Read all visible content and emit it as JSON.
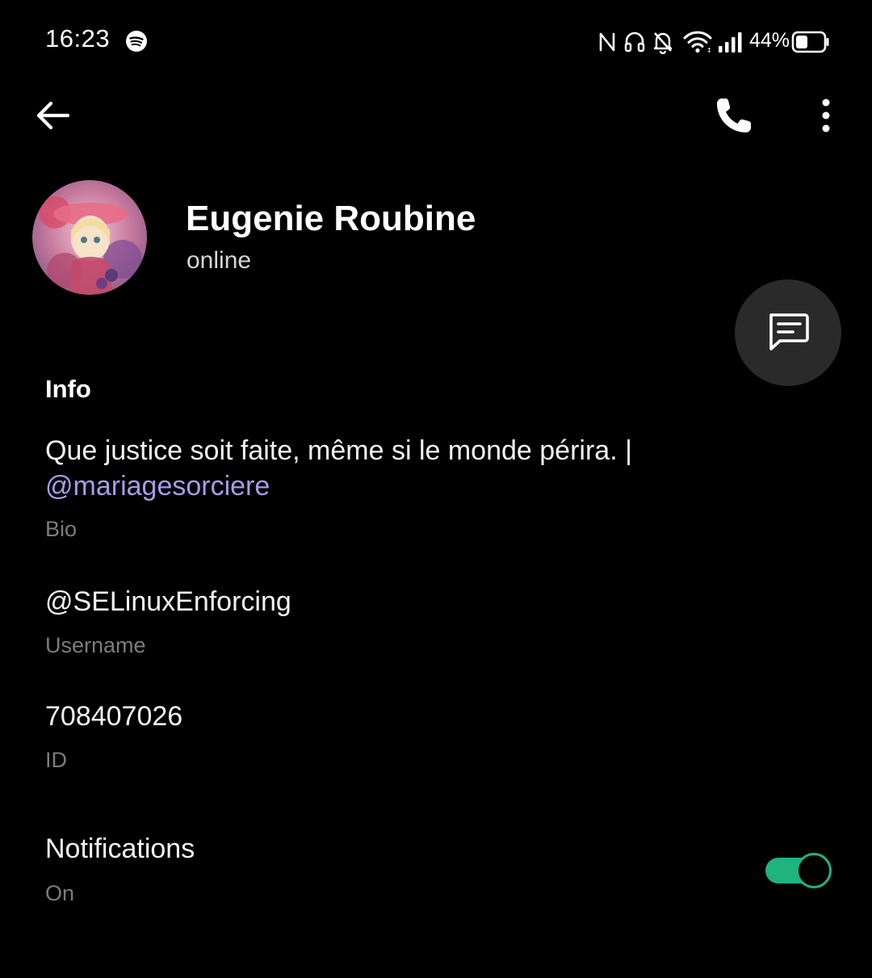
{
  "status_bar": {
    "time": "16:23",
    "battery_percent": "44%",
    "battery_level": 0.44,
    "icons": [
      "spotify-icon",
      "nfc-icon",
      "headset-icon",
      "mute-bell-icon",
      "wifi-icon",
      "signal-icon",
      "battery-icon"
    ]
  },
  "toolbar": {
    "back_icon": "arrow-left-icon",
    "call_icon": "phone-icon",
    "more_icon": "more-vertical-icon"
  },
  "profile": {
    "name": "Eugenie Roubine",
    "status": "online"
  },
  "fab": {
    "icon": "message-icon"
  },
  "info": {
    "section_title": "Info",
    "bio_text": "Que justice soit faite, même si le monde périra. |",
    "bio_link": "@mariagesorciere",
    "bio_label": "Bio",
    "username": "@SELinuxEnforcing",
    "username_label": "Username",
    "id": "708407026",
    "id_label": "ID"
  },
  "notifications": {
    "title": "Notifications",
    "state_label": "On",
    "enabled": true
  },
  "colors": {
    "background": "#000000",
    "link": "#a99be8",
    "toggle_on": "#1eb37f",
    "secondary_text": "#7c7c7c",
    "fab_background": "#2a2a2a"
  }
}
